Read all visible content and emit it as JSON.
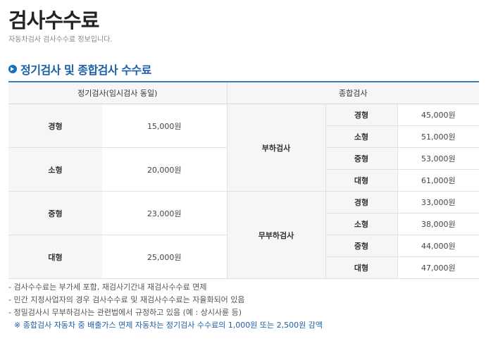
{
  "page": {
    "title": "검사수수료",
    "subtitle": "자동차검사 검사수수료 정보입니다."
  },
  "section": {
    "title": "정기검사 및 종합검사 수수료"
  },
  "table": {
    "header_left": "정기검사(임시검사 동일)",
    "header_right": "종합검사",
    "regular": [
      {
        "type": "경형",
        "fee": "15,000원"
      },
      {
        "type": "소형",
        "fee": "20,000원"
      },
      {
        "type": "중형",
        "fee": "23,000원"
      },
      {
        "type": "대형",
        "fee": "25,000원"
      }
    ],
    "comprehensive": [
      {
        "group": "부하검사",
        "rows": [
          {
            "type": "경형",
            "fee": "45,000원"
          },
          {
            "type": "소형",
            "fee": "51,000원"
          },
          {
            "type": "중형",
            "fee": "53,000원"
          },
          {
            "type": "대형",
            "fee": "61,000원"
          }
        ]
      },
      {
        "group": "무부하검사",
        "rows": [
          {
            "type": "경형",
            "fee": "33,000원"
          },
          {
            "type": "소형",
            "fee": "38,000원"
          },
          {
            "type": "중형",
            "fee": "44,000원"
          },
          {
            "type": "대형",
            "fee": "47,000원"
          }
        ]
      }
    ]
  },
  "notes": [
    "- 검사수수료는 부가세 포함, 재검사기간내 재검사수수료 면제",
    "- 민간 지정사업자의 경우 검사수수료 및 재검사수수료는 자율화되어 있음",
    "- 정밀검사시 무부하검사는 관련법에서 규정하고 있음 (예 : 상시사륜 등)"
  ],
  "special_note": "※ 종합검사 자동차 중 배출가스 면제 자동차는 정기검사 수수료의 1,000원 또는 2,500원 감액"
}
